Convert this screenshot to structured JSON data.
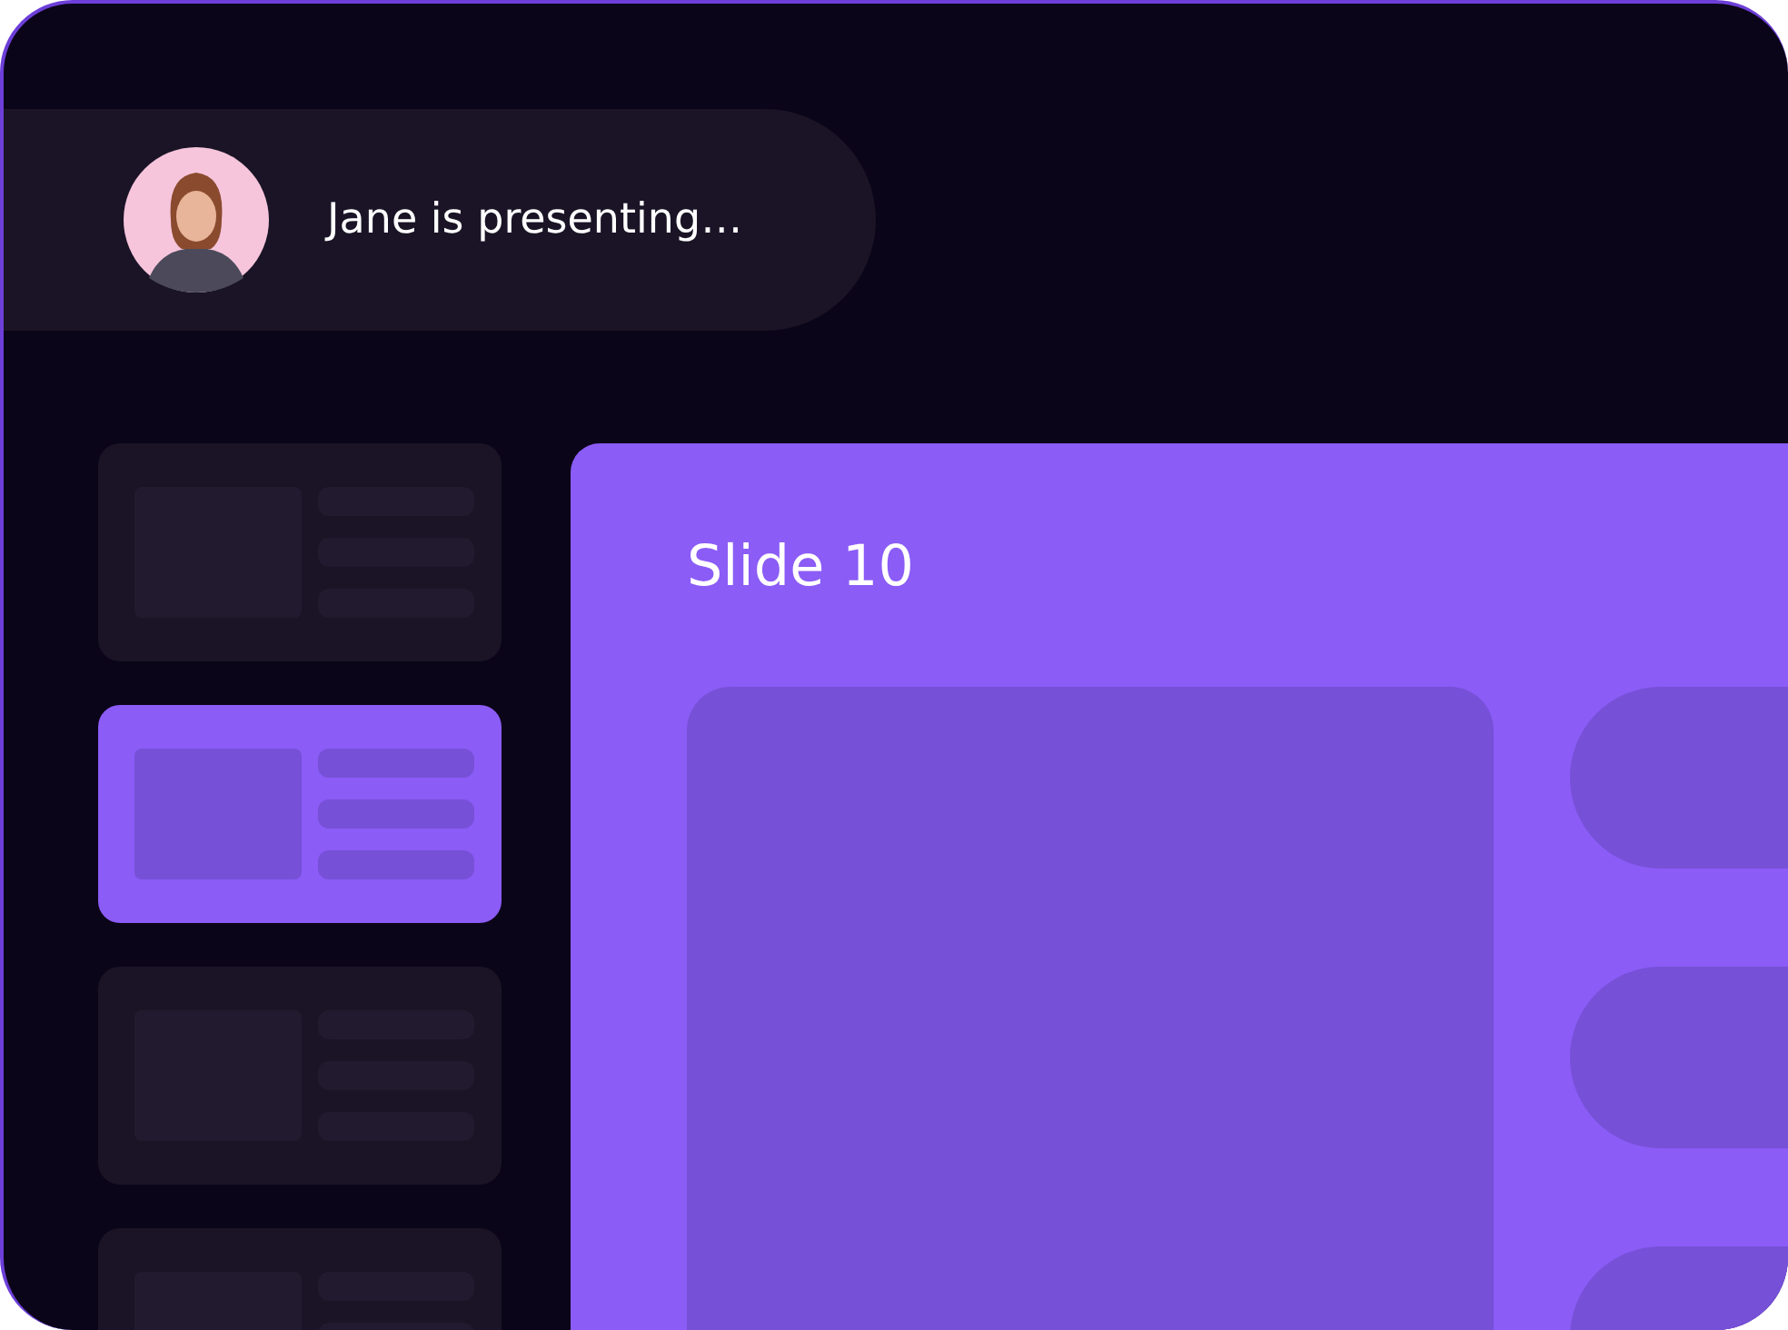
{
  "presenter": {
    "status": "Jane is presenting…"
  },
  "thumbnails": [
    {
      "selected": false
    },
    {
      "selected": true
    },
    {
      "selected": false
    },
    {
      "selected": false
    }
  ],
  "slide": {
    "title": "Slide 10"
  }
}
